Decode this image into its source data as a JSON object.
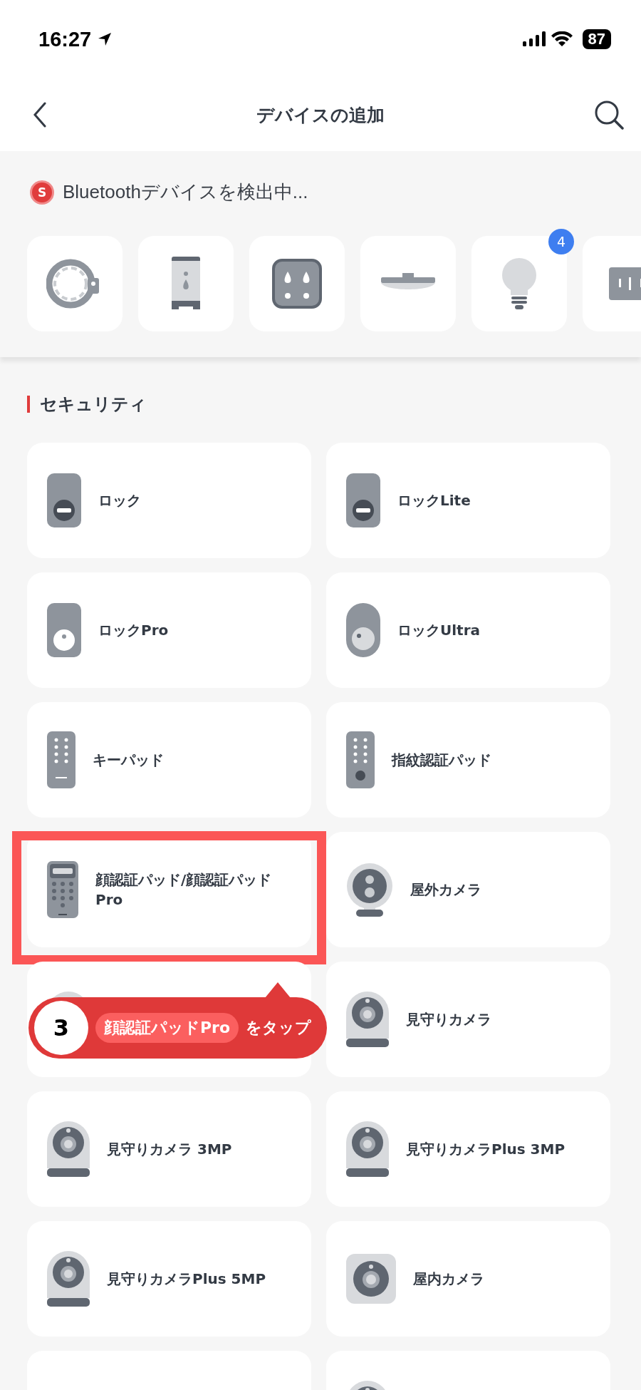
{
  "status_bar": {
    "time": "16:27",
    "battery": "87"
  },
  "nav": {
    "title": "デバイスの追加"
  },
  "scan": {
    "text": "Bluetoothデバイスを検出中...",
    "badge": "S"
  },
  "nearby": [
    {
      "kind": "ring"
    },
    {
      "kind": "dispenser"
    },
    {
      "kind": "plug"
    },
    {
      "kind": "ceiling-light"
    },
    {
      "kind": "bulb",
      "count": "4"
    },
    {
      "kind": "bar"
    }
  ],
  "section": {
    "title": "セキュリティ"
  },
  "devices": [
    {
      "kind": "lock",
      "name": "ロック"
    },
    {
      "kind": "lock",
      "name": "ロックLite"
    },
    {
      "kind": "lock-pro",
      "name": "ロックPro"
    },
    {
      "kind": "lock-ultra",
      "name": "ロックUltra"
    },
    {
      "kind": "keypad",
      "name": "キーパッド"
    },
    {
      "kind": "fingerprint-pad",
      "name": "指紋認証パッド"
    },
    {
      "kind": "face-pad",
      "name": "顔認証パッド/顔認証パッドPro",
      "selected": true
    },
    {
      "kind": "outdoor-camera",
      "name": "屋外カメラ",
      "selected": false
    },
    {
      "kind": "pan-camera"
    },
    {
      "kind": "pan-camera",
      "name": "見守りカメラ"
    },
    {
      "kind": "pan-camera",
      "name": "見守りカメラ 3MP"
    },
    {
      "kind": "pan-camera",
      "name": "見守りカメラPlus 3MP"
    },
    {
      "kind": "pan-camera",
      "name": "見守りカメラPlus 5MP"
    },
    {
      "kind": "indoor-camera",
      "name": "屋内カメラ"
    },
    {
      "kind": "blank"
    },
    {
      "kind": "pan-camera"
    }
  ],
  "callout": {
    "step": "3",
    "target": "顔認証パッドPro",
    "action": "をタップ"
  }
}
